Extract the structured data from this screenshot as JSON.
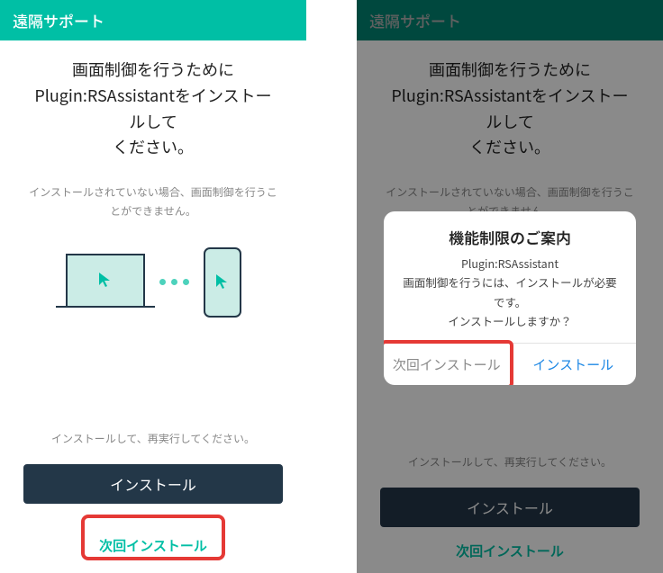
{
  "header": {
    "title": "遠隔サポート"
  },
  "title_line1": "画面制御を行うために",
  "title_line2": "Plugin:RSAssistantをインストールして",
  "title_line3": "ください。",
  "subtext": "インストールされていない場合、画面制御を行うことができません。",
  "footer_hint": "インストールして、再実行してください。",
  "buttons": {
    "install": "インストール",
    "install_later": "次回インストール"
  },
  "dialog": {
    "title": "機能制限のご案内",
    "body_line1": "Plugin:RSAssistant",
    "body_line2": "画面制御を行うには、インストールが必要です。",
    "body_line3": "インストールしますか？",
    "later": "次回インストール",
    "install": "インストール"
  },
  "colors": {
    "accent": "#00bfa5",
    "dark": "#233748",
    "highlight": "#e53935",
    "dialog_install": "#1e88e5"
  }
}
